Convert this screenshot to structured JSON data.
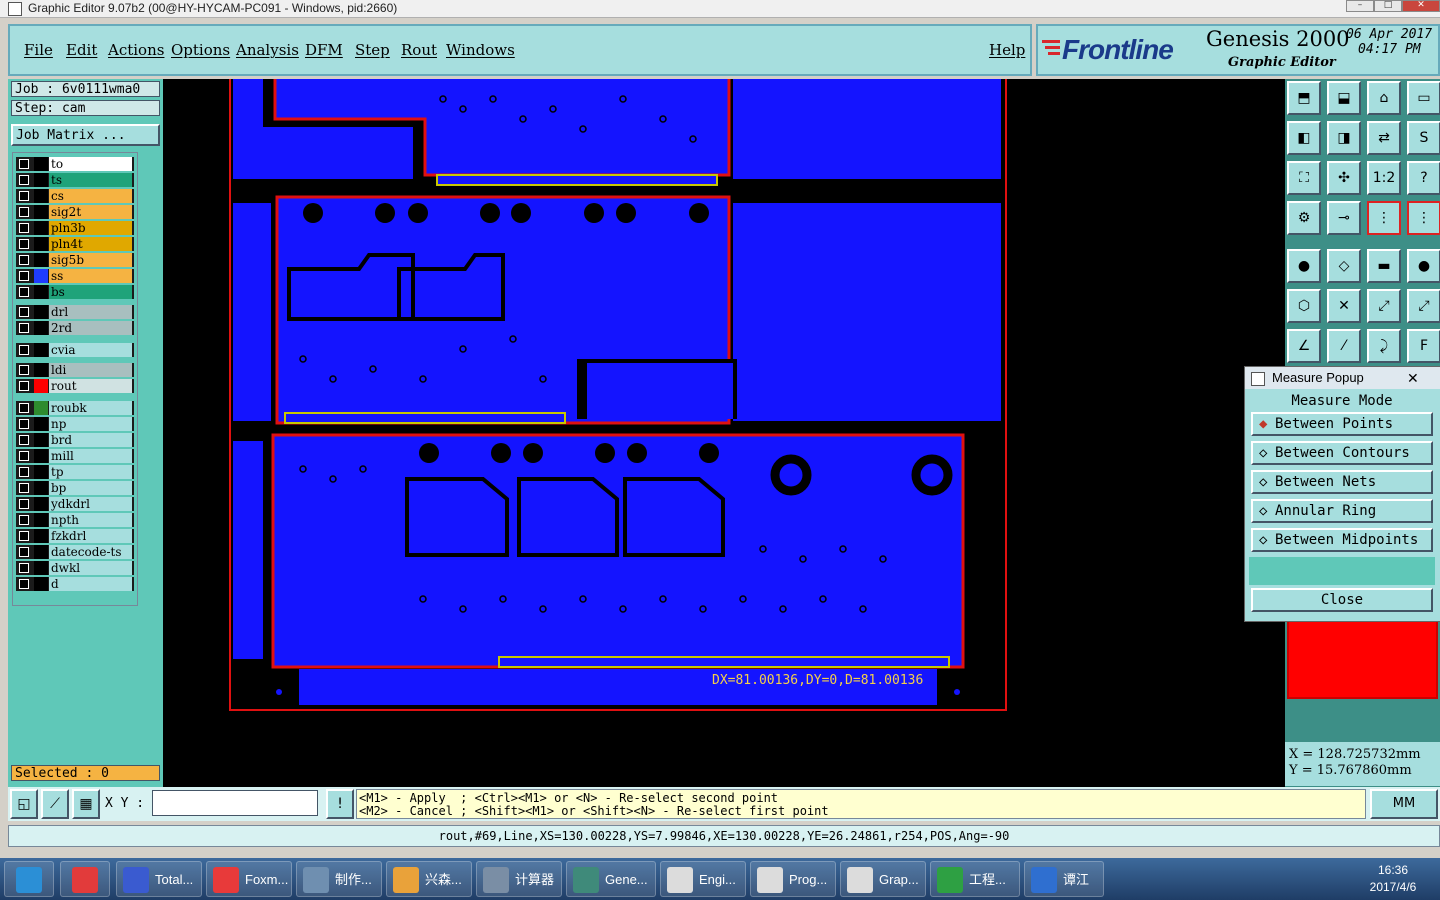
{
  "window": {
    "title": "Graphic Editor 9.07b2 (00@HY-HYCAM-PC091 - Windows, pid:2660)",
    "controls": [
      "–",
      "□",
      "✕"
    ]
  },
  "menu": {
    "items": [
      "File",
      "Edit",
      "Actions",
      "Options",
      "Analysis",
      "DFM",
      "Step",
      "Rout",
      "Windows"
    ],
    "help": "Help"
  },
  "brand": {
    "logo": "Frontline",
    "product": "Genesis 2000",
    "subtitle": "Graphic Editor",
    "date": "06 Apr 2017",
    "time": "04:17 PM"
  },
  "job": {
    "job_label": "Job : 6v0111wma0",
    "step_label": "Step: cam",
    "matrix_button": "Job Matrix ...",
    "selected_label": "Selected : 0"
  },
  "layers": [
    {
      "name": "to",
      "color": "#ffffff",
      "swatch": "#000000"
    },
    {
      "name": "ts",
      "color": "#1fa37a",
      "swatch": "#000000"
    },
    {
      "name": "cs",
      "color": "#f5b342",
      "swatch": "#000000"
    },
    {
      "name": "sig2t",
      "color": "#f5b342",
      "swatch": "#000000"
    },
    {
      "name": "pln3b",
      "color": "#e0a800",
      "swatch": "#000000"
    },
    {
      "name": "pln4t",
      "color": "#e0a800",
      "swatch": "#000000"
    },
    {
      "name": "sig5b",
      "color": "#f5b342",
      "swatch": "#000000"
    },
    {
      "name": "ss",
      "color": "#f5b342",
      "swatch": "#1f3cff"
    },
    {
      "name": "bs",
      "color": "#1fa37a",
      "swatch": "#000000"
    },
    {
      "name": "drl",
      "color": "#a8bfbf",
      "swatch": "#000000"
    },
    {
      "name": "2rd",
      "color": "#a8bfbf",
      "swatch": "#000000"
    },
    {
      "name": "cvia",
      "color": "#a6dede",
      "swatch": "#000000"
    },
    {
      "name": "ldi",
      "color": "#a8bfbf",
      "swatch": "#000000"
    },
    {
      "name": "rout",
      "color": "#d0e2e2",
      "swatch": "#ff0000"
    },
    {
      "name": "roubk",
      "color": "#a6dede",
      "swatch": "#2e8b2e"
    },
    {
      "name": "np",
      "color": "#a6dede",
      "swatch": "#000000"
    },
    {
      "name": "brd",
      "color": "#a6dede",
      "swatch": "#000000"
    },
    {
      "name": "mill",
      "color": "#a6dede",
      "swatch": "#000000"
    },
    {
      "name": "tp",
      "color": "#a6dede",
      "swatch": "#000000"
    },
    {
      "name": "bp",
      "color": "#a6dede",
      "swatch": "#000000"
    },
    {
      "name": "ydkdrl",
      "color": "#a6dede",
      "swatch": "#000000"
    },
    {
      "name": "npth",
      "color": "#a6dede",
      "swatch": "#000000"
    },
    {
      "name": "fzkdrl",
      "color": "#a6dede",
      "swatch": "#000000"
    },
    {
      "name": "datecode-ts",
      "color": "#a6dede",
      "swatch": "#000000"
    },
    {
      "name": "dwkl",
      "color": "#a6dede",
      "swatch": "#000000"
    },
    {
      "name": "d",
      "color": "#a6dede",
      "swatch": "#000000"
    }
  ],
  "canvas": {
    "measure_text": "DX=81.00136,DY=0,D=81.00136"
  },
  "measure_popup": {
    "title": "Measure Popup",
    "heading": "Measure Mode",
    "modes": [
      "Between Points",
      "Between Contours",
      "Between Nets",
      "Annular Ring",
      "Between Midpoints"
    ],
    "selected_mode": "Between Points",
    "close_label": "Close"
  },
  "coords": {
    "x": "X = 128.725732mm",
    "y": "Y = 15.767860mm"
  },
  "command": {
    "xy_label": "X Y :",
    "input_value": "",
    "hint1": "<M1> - Apply  ; <Ctrl><M1> or <N> - Re-select second point",
    "hint2": "<M2> - Cancel ; <Shift><M1> or <Shift><N> - Re-select first point",
    "units": "MM",
    "info_icon": "!"
  },
  "status": "rout,#69,Line,XS=130.00228,YS=7.99846,XE=130.00228,YE=26.24861,r254,POS,Ang=-90",
  "taskbar": {
    "items": [
      {
        "label": "",
        "icon": "start-orb-icon",
        "color": "#2b8fd6"
      },
      {
        "label": "",
        "icon": "app-icon",
        "color": "#e23b3b"
      },
      {
        "label": "Total...",
        "icon": "floppy-icon",
        "color": "#3a5bd0"
      },
      {
        "label": "Foxm...",
        "icon": "foxmail-icon",
        "color": "#e83a3a"
      },
      {
        "label": "制作...",
        "icon": "document-icon",
        "color": "#6f8fb0"
      },
      {
        "label": "兴森...",
        "icon": "shell-icon",
        "color": "#e9a23a"
      },
      {
        "label": "计算器",
        "icon": "calculator-icon",
        "color": "#7a8ea5"
      },
      {
        "label": "Gene...",
        "icon": "genesis-icon",
        "color": "#3f8a7a"
      },
      {
        "label": "Engi...",
        "icon": "x-window-icon",
        "color": "#dcdcdc"
      },
      {
        "label": "Prog...",
        "icon": "x-window-icon",
        "color": "#dcdcdc"
      },
      {
        "label": "Grap...",
        "icon": "x-window-icon",
        "color": "#dcdcdc"
      },
      {
        "label": "工程...",
        "icon": "f-green-icon",
        "color": "#2ea043"
      },
      {
        "label": "谭江",
        "icon": "frontline-icon",
        "color": "#2f6fd0"
      }
    ],
    "clock_time": "16:36",
    "clock_date": "2017/4/6"
  }
}
